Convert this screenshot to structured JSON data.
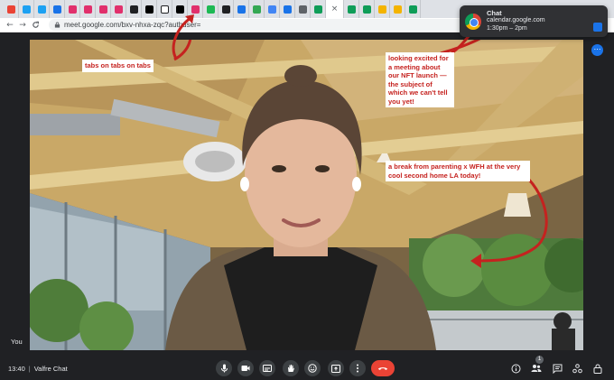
{
  "browser": {
    "tabs": [
      {
        "icon": "mail-icon",
        "color": "#ea4335"
      },
      {
        "icon": "twitter-icon",
        "color": "#1da1f2"
      },
      {
        "icon": "twitter-icon",
        "color": "#1da1f2"
      },
      {
        "icon": "site-icon",
        "color": "#1a73e8"
      },
      {
        "icon": "instagram-icon",
        "color": "#e1306c"
      },
      {
        "icon": "instagram-icon",
        "color": "#e1306c"
      },
      {
        "icon": "instagram-icon",
        "color": "#e1306c"
      },
      {
        "icon": "instagram-icon",
        "color": "#e1306c"
      },
      {
        "icon": "site-icon",
        "color": "#202124"
      },
      {
        "icon": "circle-icon",
        "color": "#000000"
      },
      {
        "icon": "notion-icon",
        "color": "#ffffff"
      },
      {
        "icon": "circle-icon",
        "color": "#000000"
      },
      {
        "icon": "instagram-icon",
        "color": "#e1306c"
      },
      {
        "icon": "circle-icon",
        "color": "#1db954"
      },
      {
        "icon": "site-icon",
        "color": "#202124"
      },
      {
        "icon": "doc-icon",
        "color": "#1a73e8"
      },
      {
        "icon": "drive-icon",
        "color": "#34a853"
      },
      {
        "icon": "photos-icon",
        "color": "#4285f4"
      },
      {
        "icon": "calendar-icon",
        "color": "#1a73e8"
      },
      {
        "icon": "link-icon",
        "color": "#5f6368"
      },
      {
        "icon": "sheets-icon",
        "color": "#0f9d58"
      }
    ],
    "active_tab_close": "×",
    "extra_tabs": [
      {
        "icon": "sheets-icon",
        "color": "#0f9d58"
      },
      {
        "icon": "sheets-icon",
        "color": "#0f9d58"
      },
      {
        "icon": "slides-icon",
        "color": "#f4b400"
      },
      {
        "icon": "slides-icon",
        "color": "#f4b400"
      },
      {
        "icon": "sheets-icon",
        "color": "#0f9d58"
      }
    ],
    "nav": {
      "back": "←",
      "forward": "→",
      "reload": "C"
    },
    "url": "meet.google.com/bxv-nhxa-zqc?authuser="
  },
  "notification": {
    "title": "Chat",
    "source": "calendar.google.com",
    "time": "1:30pm – 2pm"
  },
  "annotations": {
    "tabs": "tabs on tabs on tabs",
    "meeting": "looking excited for a meeting about our NFT launch — the subject of which we can't tell you yet!",
    "location": "a break from parenting x WFH at the very cool second home LA today!"
  },
  "annotation_color": "#c5221f",
  "video": {
    "self_label": "You"
  },
  "meet": {
    "time": "13:40",
    "separator": "|",
    "meeting_name": "Valfre Chat",
    "people_count": "1",
    "controls": [
      "microphone-icon",
      "camera-icon",
      "captions-icon",
      "raise-hand-icon",
      "emoji-icon",
      "present-icon",
      "more-options-icon",
      "end-call-icon"
    ],
    "right_controls": [
      "info-icon",
      "people-icon",
      "chat-icon",
      "activities-icon",
      "host-controls-icon"
    ]
  }
}
